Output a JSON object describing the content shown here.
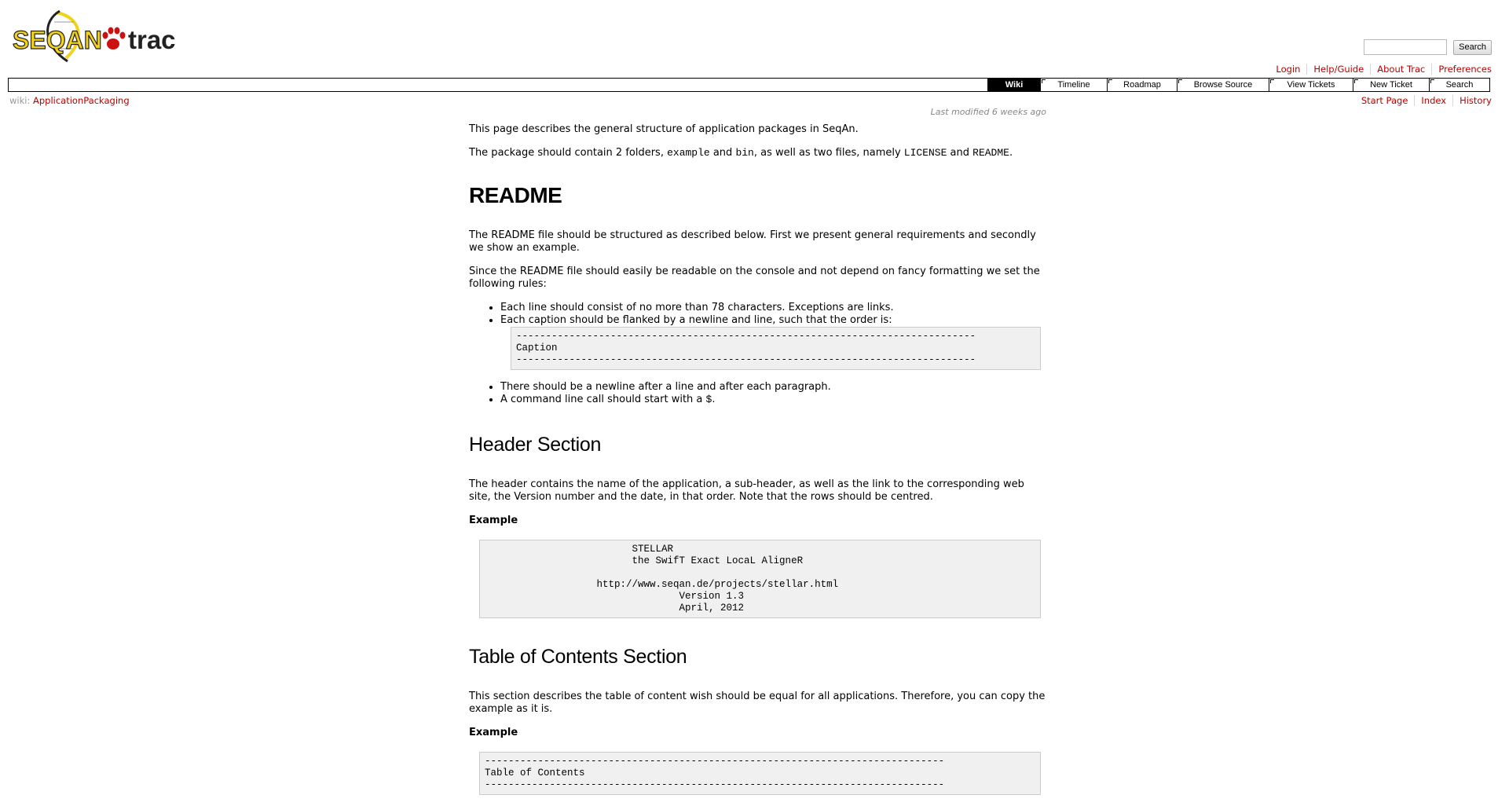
{
  "logo": {
    "seqan_text": "SEQAN",
    "trac_text": "trac",
    "colors": {
      "seqan_yellow": "#f2d21b",
      "seqan_dark": "#222222",
      "trac_paw": "#cc1111"
    }
  },
  "search": {
    "placeholder": "",
    "value": "",
    "button_label": "Search"
  },
  "metanav": [
    "Login",
    "Help/Guide",
    "About Trac",
    "Preferences"
  ],
  "mainnav": [
    {
      "label": "Wiki",
      "active": true
    },
    {
      "label": "Timeline",
      "active": false
    },
    {
      "label": "Roadmap",
      "active": false
    },
    {
      "label": "Browse Source",
      "active": false
    },
    {
      "label": "View Tickets",
      "active": false
    },
    {
      "label": "New Ticket",
      "active": false
    },
    {
      "label": "Search",
      "active": false
    }
  ],
  "pagepath": {
    "prefix": "wiki:",
    "page": "ApplicationPackaging"
  },
  "ctxtnav": [
    "Start Page",
    "Index",
    "History"
  ],
  "content": {
    "last_modified": "Last modified 6 weeks ago",
    "intro": "This page describes the general structure of application packages in SeqAn.",
    "package_p": {
      "t1": "The package should contain 2 folders, ",
      "c1": "example",
      "t2": " and ",
      "c2": "bin",
      "t3": ", as well as two files, namely ",
      "c3": "LICENSE",
      "t4": " and ",
      "c4": "README",
      "t5": "."
    },
    "h_readme": "README",
    "readme_p1": "The README file should be structured as described below. First we present general requirements and secondly we show an example.",
    "readme_p2": "Since the README file should easily be readable on the console and not depend on fancy formatting we set the following rules:",
    "rules_a": [
      "Each line should consist of no more than 78 characters. Exceptions are links.",
      "Each caption should be flanked by a newline and line, such that the order is:"
    ],
    "caption_pre": "------------------------------------------------------------------------------\nCaption\n------------------------------------------------------------------------------",
    "rules_b": [
      "There should be a newline after a line and after each paragraph."
    ],
    "rule_cmd": {
      "text": "A command line call should start with a ",
      "code": "$",
      "end": "."
    },
    "h_header": "Header Section",
    "header_p": "The header contains the name of the application, a sub-header, as well as the link to the corresponding web site, the Version number and the date, in that order. Note that the rows should be centred.",
    "example_label": "Example",
    "header_pre": "                         STELLAR\n                         the SwifT Exact LocaL AligneR\n\n                   http://www.seqan.de/projects/stellar.html\n                                 Version 1.3\n                                 April, 2012",
    "h_toc": "Table of Contents Section",
    "toc_p": "This section describes the table of content wish should be equal for all applications. Therefore, you can copy the example as it is.",
    "example_label_2": "Example",
    "toc_pre": "------------------------------------------------------------------------------\nTable of Contents\n------------------------------------------------------------------------------"
  }
}
